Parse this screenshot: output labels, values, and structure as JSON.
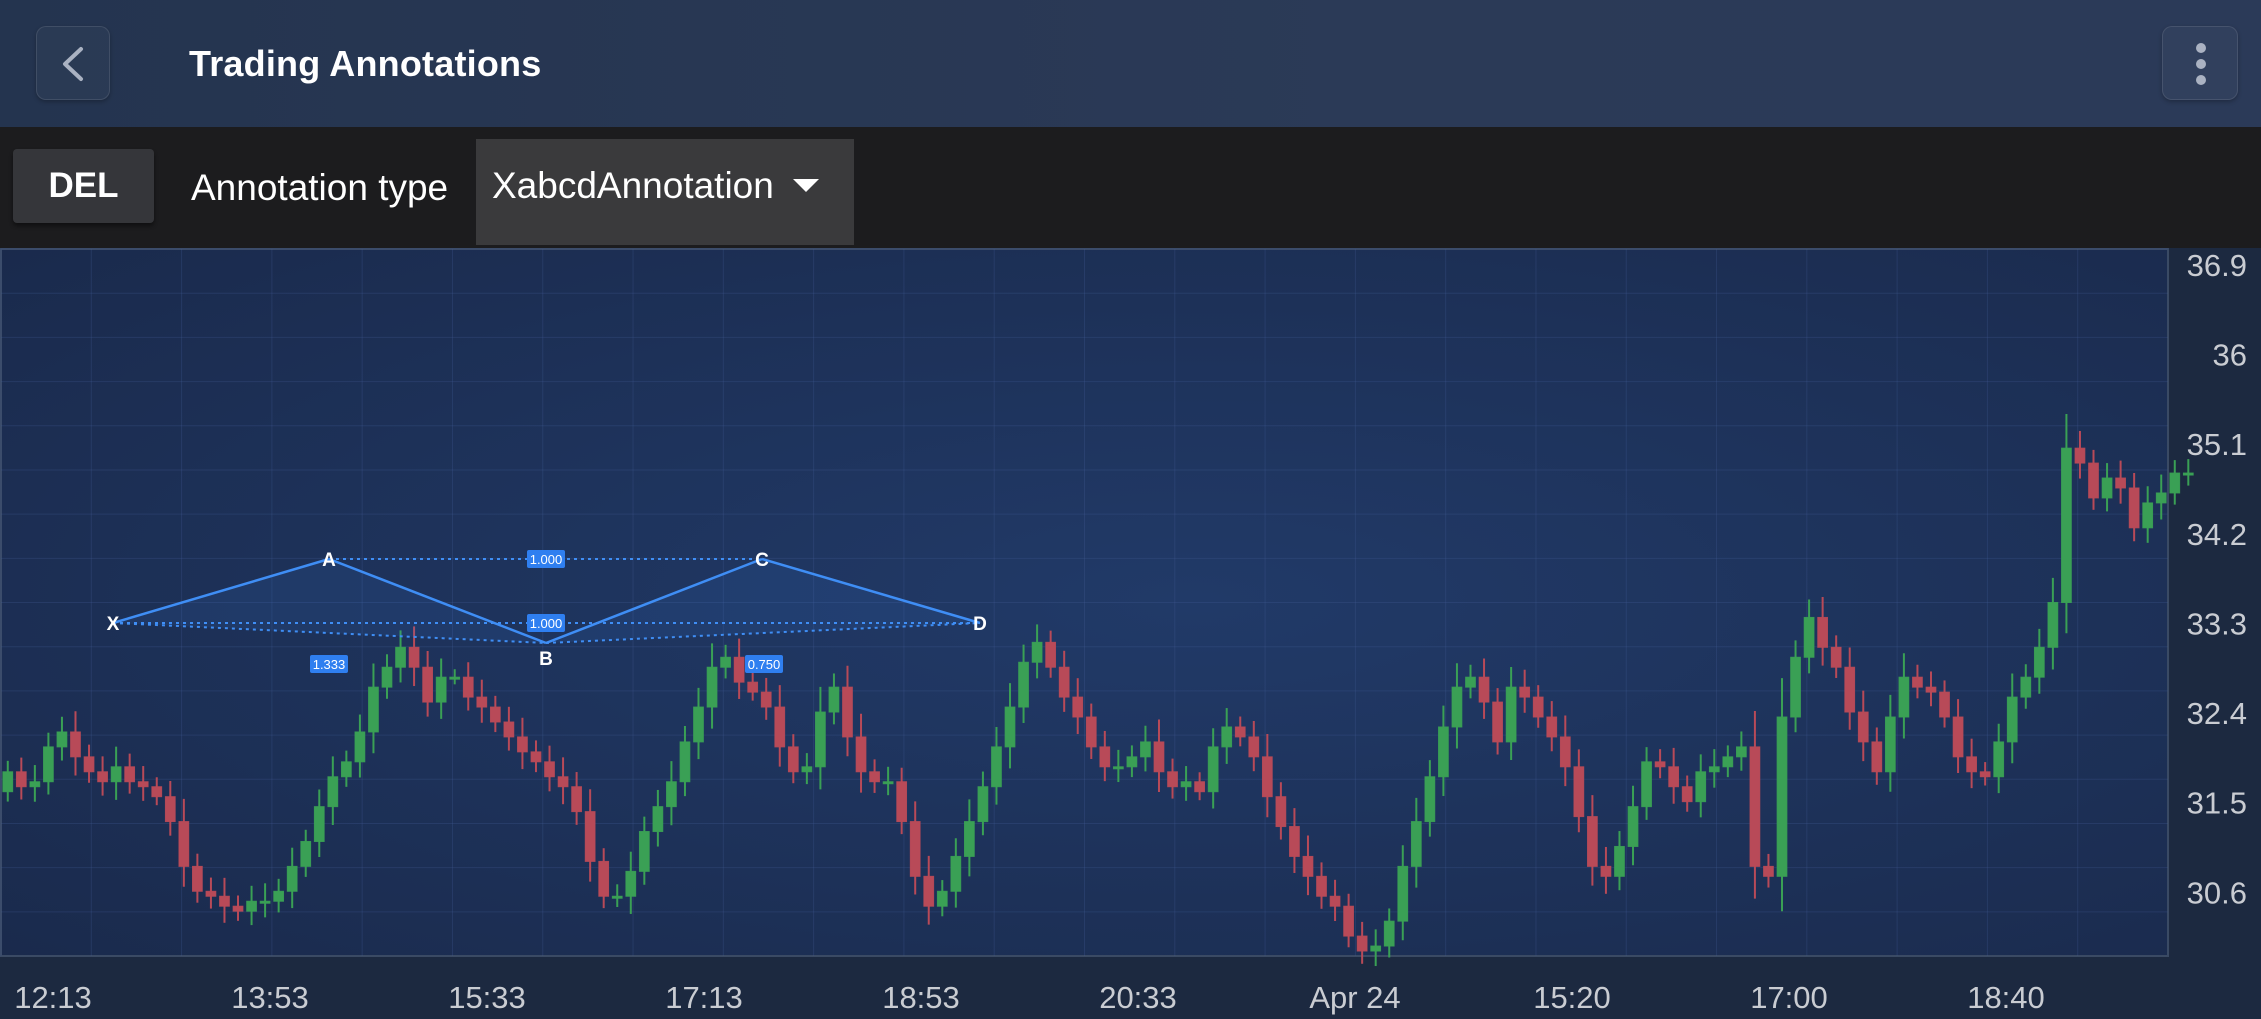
{
  "app_bar": {
    "title": "Trading Annotations",
    "back_icon": "chevron-left-icon",
    "menu_icon": "more-vertical-icon"
  },
  "toolbar": {
    "delete_label": "DEL",
    "annotation_type_label": "Annotation type",
    "annotation_type_value": "XabcdAnnotation",
    "dropdown_icon": "caret-down-icon"
  },
  "colors": {
    "up_candle": "#3aa055",
    "down_candle": "#b84a58",
    "annotation": "#3f8ef5",
    "annotation_label_bg": "#2f7ff0",
    "plot_background": "#1c2d52",
    "axis_text": "#c9ccd2"
  },
  "chart_data": {
    "type": "candlestick",
    "y_axis_position": "right",
    "y_ticks": [
      "36.9",
      "36",
      "35.1",
      "34.2",
      "33.3",
      "32.4",
      "31.5",
      "30.6"
    ],
    "ylim": [
      29.95,
      37.05
    ],
    "x_ticks": [
      "12:13",
      "13:53",
      "15:33",
      "17:13",
      "18:53",
      "20:33",
      "Apr 24",
      "15:20",
      "17:00",
      "18:40"
    ],
    "candle_count": 160,
    "grid": true,
    "closes": [
      31.8,
      31.65,
      31.7,
      32.05,
      32.2,
      31.95,
      31.8,
      31.7,
      31.85,
      31.7,
      31.65,
      31.55,
      31.3,
      30.85,
      30.6,
      30.55,
      30.45,
      30.4,
      30.5,
      30.5,
      30.6,
      30.85,
      31.1,
      31.45,
      31.75,
      31.9,
      32.2,
      32.65,
      32.85,
      33.05,
      32.85,
      32.5,
      32.75,
      32.75,
      32.55,
      32.45,
      32.3,
      32.15,
      32.0,
      31.9,
      31.75,
      31.65,
      31.4,
      30.9,
      30.55,
      30.55,
      30.8,
      31.2,
      31.45,
      31.7,
      32.1,
      32.45,
      32.85,
      32.95,
      32.7,
      32.6,
      32.45,
      32.05,
      31.8,
      31.85,
      32.4,
      32.65,
      32.15,
      31.8,
      31.7,
      31.7,
      31.3,
      30.75,
      30.45,
      30.6,
      30.95,
      31.3,
      31.65,
      32.05,
      32.45,
      32.9,
      33.1,
      32.85,
      32.55,
      32.35,
      32.05,
      31.85,
      31.85,
      31.95,
      32.1,
      31.8,
      31.65,
      31.7,
      31.6,
      32.05,
      32.25,
      32.15,
      31.95,
      31.55,
      31.25,
      30.95,
      30.75,
      30.55,
      30.45,
      30.15,
      30.0,
      30.05,
      30.3,
      30.85,
      31.3,
      31.75,
      32.25,
      32.65,
      32.75,
      32.5,
      32.1,
      32.65,
      32.55,
      32.35,
      32.15,
      31.85,
      31.35,
      30.85,
      30.75,
      31.05,
      31.45,
      31.9,
      31.85,
      31.65,
      31.5,
      31.8,
      31.85,
      31.95,
      32.05,
      30.85,
      30.75,
      32.35,
      32.95,
      33.35,
      33.05,
      32.85,
      32.4,
      32.1,
      31.8,
      32.35,
      32.75,
      32.65,
      32.6,
      32.35,
      31.95,
      31.8,
      31.75,
      32.1,
      32.55,
      32.75,
      33.05,
      33.5,
      35.05,
      34.9,
      34.55,
      34.75,
      34.65,
      34.25,
      34.5,
      34.6,
      34.8,
      34.8
    ]
  }
}
